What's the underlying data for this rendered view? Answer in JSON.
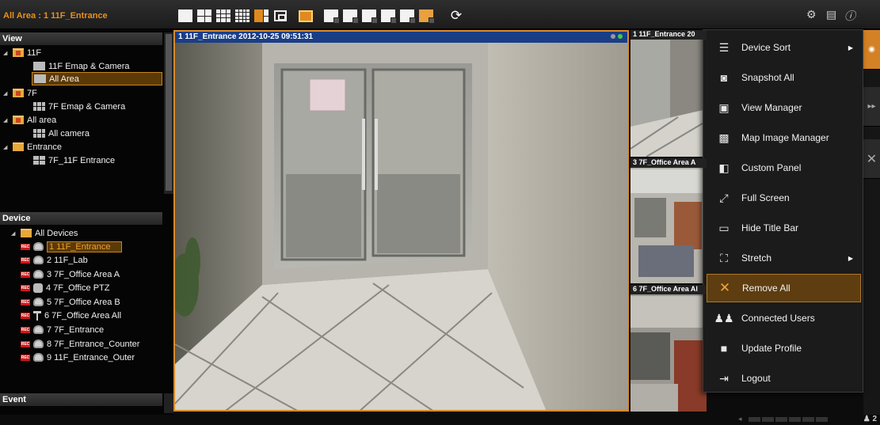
{
  "window": {
    "title": "All Area : 1 11F_Entrance"
  },
  "toolbar": {
    "layouts": [
      "1-view",
      "4-view",
      "9-view",
      "16-view",
      "6-view",
      "popup"
    ],
    "icons": [
      "layout-1-icon",
      "layout-4-icon",
      "layout-9-icon",
      "layout-16-icon",
      "layout-6-icon",
      "popup-window-icon",
      "monitor-icon",
      "emap-edit-icon",
      "emap-add-icon",
      "emap-delete-icon",
      "emap-link-icon",
      "emap-export-icon",
      "emap-settings-icon",
      "sync-icon"
    ],
    "right_icons": [
      "settings-icon",
      "document-icon",
      "info-icon"
    ]
  },
  "left_panel": {
    "view_header": "View",
    "view_tree": [
      {
        "label": "11F",
        "level": 0,
        "type": "folder-red"
      },
      {
        "label": "11F Emap & Camera",
        "level": 1,
        "type": "grid-1"
      },
      {
        "label": "All Area",
        "level": 1,
        "type": "grid-1-star",
        "selected": true
      },
      {
        "label": "7F",
        "level": 0,
        "type": "folder-red"
      },
      {
        "label": "7F Emap & Camera",
        "level": 1,
        "type": "grid-9"
      },
      {
        "label": "All area",
        "level": 0,
        "type": "folder-red"
      },
      {
        "label": "All camera",
        "level": 1,
        "type": "grid-9"
      },
      {
        "label": "Entrance",
        "level": 0,
        "type": "folder"
      },
      {
        "label": "7F_11F Entrance",
        "level": 1,
        "type": "grid-4"
      }
    ],
    "device_header": "Device",
    "device_root": "All Devices",
    "devices": [
      {
        "label": "1 11F_Entrance",
        "selected": true,
        "rec": "REC"
      },
      {
        "label": "2 11F_Lab",
        "rec": "REC"
      },
      {
        "label": "3 7F_Office Area A",
        "rec": "REC"
      },
      {
        "label": "4 7F_Office PTZ",
        "rec": "REC"
      },
      {
        "label": "5 7F_Office Area B",
        "rec": "REC"
      },
      {
        "label": "6 7F_Office Area All",
        "rec": "REC"
      },
      {
        "label": "7 7F_Entrance",
        "rec": "REC"
      },
      {
        "label": "8 7F_Entrance_Counter",
        "rec": "REC"
      },
      {
        "label": "9 11F_Entrance_Outer",
        "rec": "REC"
      }
    ],
    "event_header": "Event"
  },
  "main_view": {
    "title": "1 11F_Entrance  2012-10-25 09:51:31"
  },
  "thumbnails": [
    {
      "title": "1 11F_Entrance  20"
    },
    {
      "title": "3 7F_Office Area A"
    },
    {
      "title": "6 7F_Office Area Al"
    }
  ],
  "menu": {
    "items": [
      {
        "label": "Device Sort",
        "icon": "list-icon",
        "submenu": true
      },
      {
        "label": "Snapshot All",
        "icon": "camera-icon"
      },
      {
        "label": "View Manager",
        "icon": "view-manager-icon"
      },
      {
        "label": "Map Image Manager",
        "icon": "map-image-icon"
      },
      {
        "label": "Custom Panel",
        "icon": "panel-icon"
      },
      {
        "label": "Full Screen",
        "icon": "fullscreen-icon"
      },
      {
        "label": "Hide Title Bar",
        "icon": "title-bar-icon"
      },
      {
        "label": "Stretch",
        "icon": "stretch-icon",
        "submenu": true
      },
      {
        "label": "Remove All",
        "icon": "remove-icon",
        "highlighted": true
      },
      {
        "label": "Connected Users",
        "icon": "users-icon"
      },
      {
        "label": "Update Profile",
        "icon": "lock-icon"
      },
      {
        "label": "Logout",
        "icon": "logout-icon"
      }
    ]
  },
  "status_bar": {
    "connected_users": "2"
  },
  "colors": {
    "accent": "#e08a1e",
    "title_bar_blue": "#1a3e86",
    "rec_red": "#d01818"
  }
}
